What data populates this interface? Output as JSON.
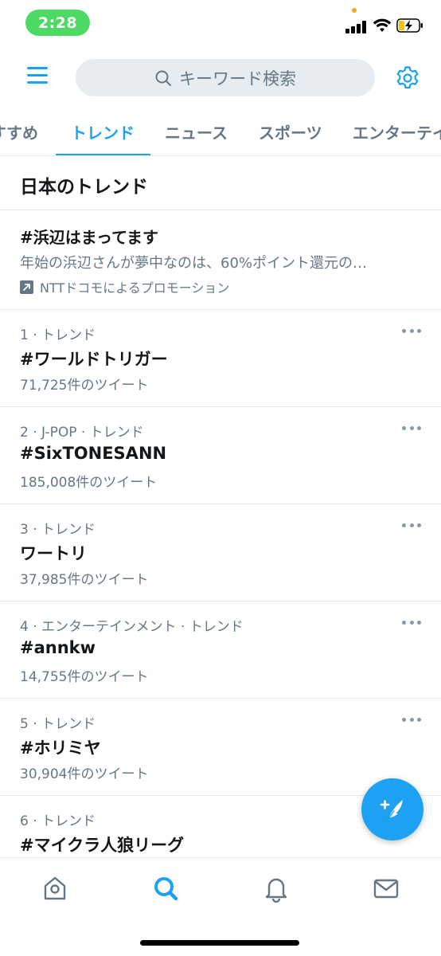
{
  "status": {
    "time": "2:28"
  },
  "search": {
    "placeholder": "キーワード検索"
  },
  "tabs": [
    {
      "label": "すすめ"
    },
    {
      "label": "トレンド"
    },
    {
      "label": "ニュース"
    },
    {
      "label": "スポーツ"
    },
    {
      "label": "エンターテイ"
    }
  ],
  "section_title": "日本のトレンド",
  "promoted": {
    "title": "#浜辺はまってます",
    "description": "年始の浜辺さんが夢中なのは、60%ポイント還元の…",
    "by": "NTTドコモによるプロモーション"
  },
  "trends": [
    {
      "meta": "1 · トレンド",
      "name": "#ワールドトリガー",
      "count": "71,725件のツイート"
    },
    {
      "meta": "2 · J-POP · トレンド",
      "name": "#SixTONESANN",
      "count": "185,008件のツイート"
    },
    {
      "meta": "3 · トレンド",
      "name": "ワートリ",
      "count": "37,985件のツイート"
    },
    {
      "meta": "4 · エンターテインメント · トレンド",
      "name": "#annkw",
      "count": "14,755件のツイート"
    },
    {
      "meta": "5 · トレンド",
      "name": "#ホリミヤ",
      "count": "30,904件のツイート"
    },
    {
      "meta": "6 · トレンド",
      "name": "#マイクラ人狼リーグ",
      "count": ""
    }
  ],
  "icons": {
    "menu": "menu-icon",
    "search": "search-icon",
    "settings": "gear-icon",
    "more": "more-icon",
    "compose": "compose-tweet-icon",
    "home": "home-icon",
    "explore": "search-icon",
    "notifications": "bell-icon",
    "messages": "envelope-icon",
    "promoted": "promoted-arrow-icon"
  },
  "colors": {
    "accent": "#1da1f2",
    "secondary_text": "#657786",
    "time_pill": "#4cd964"
  }
}
